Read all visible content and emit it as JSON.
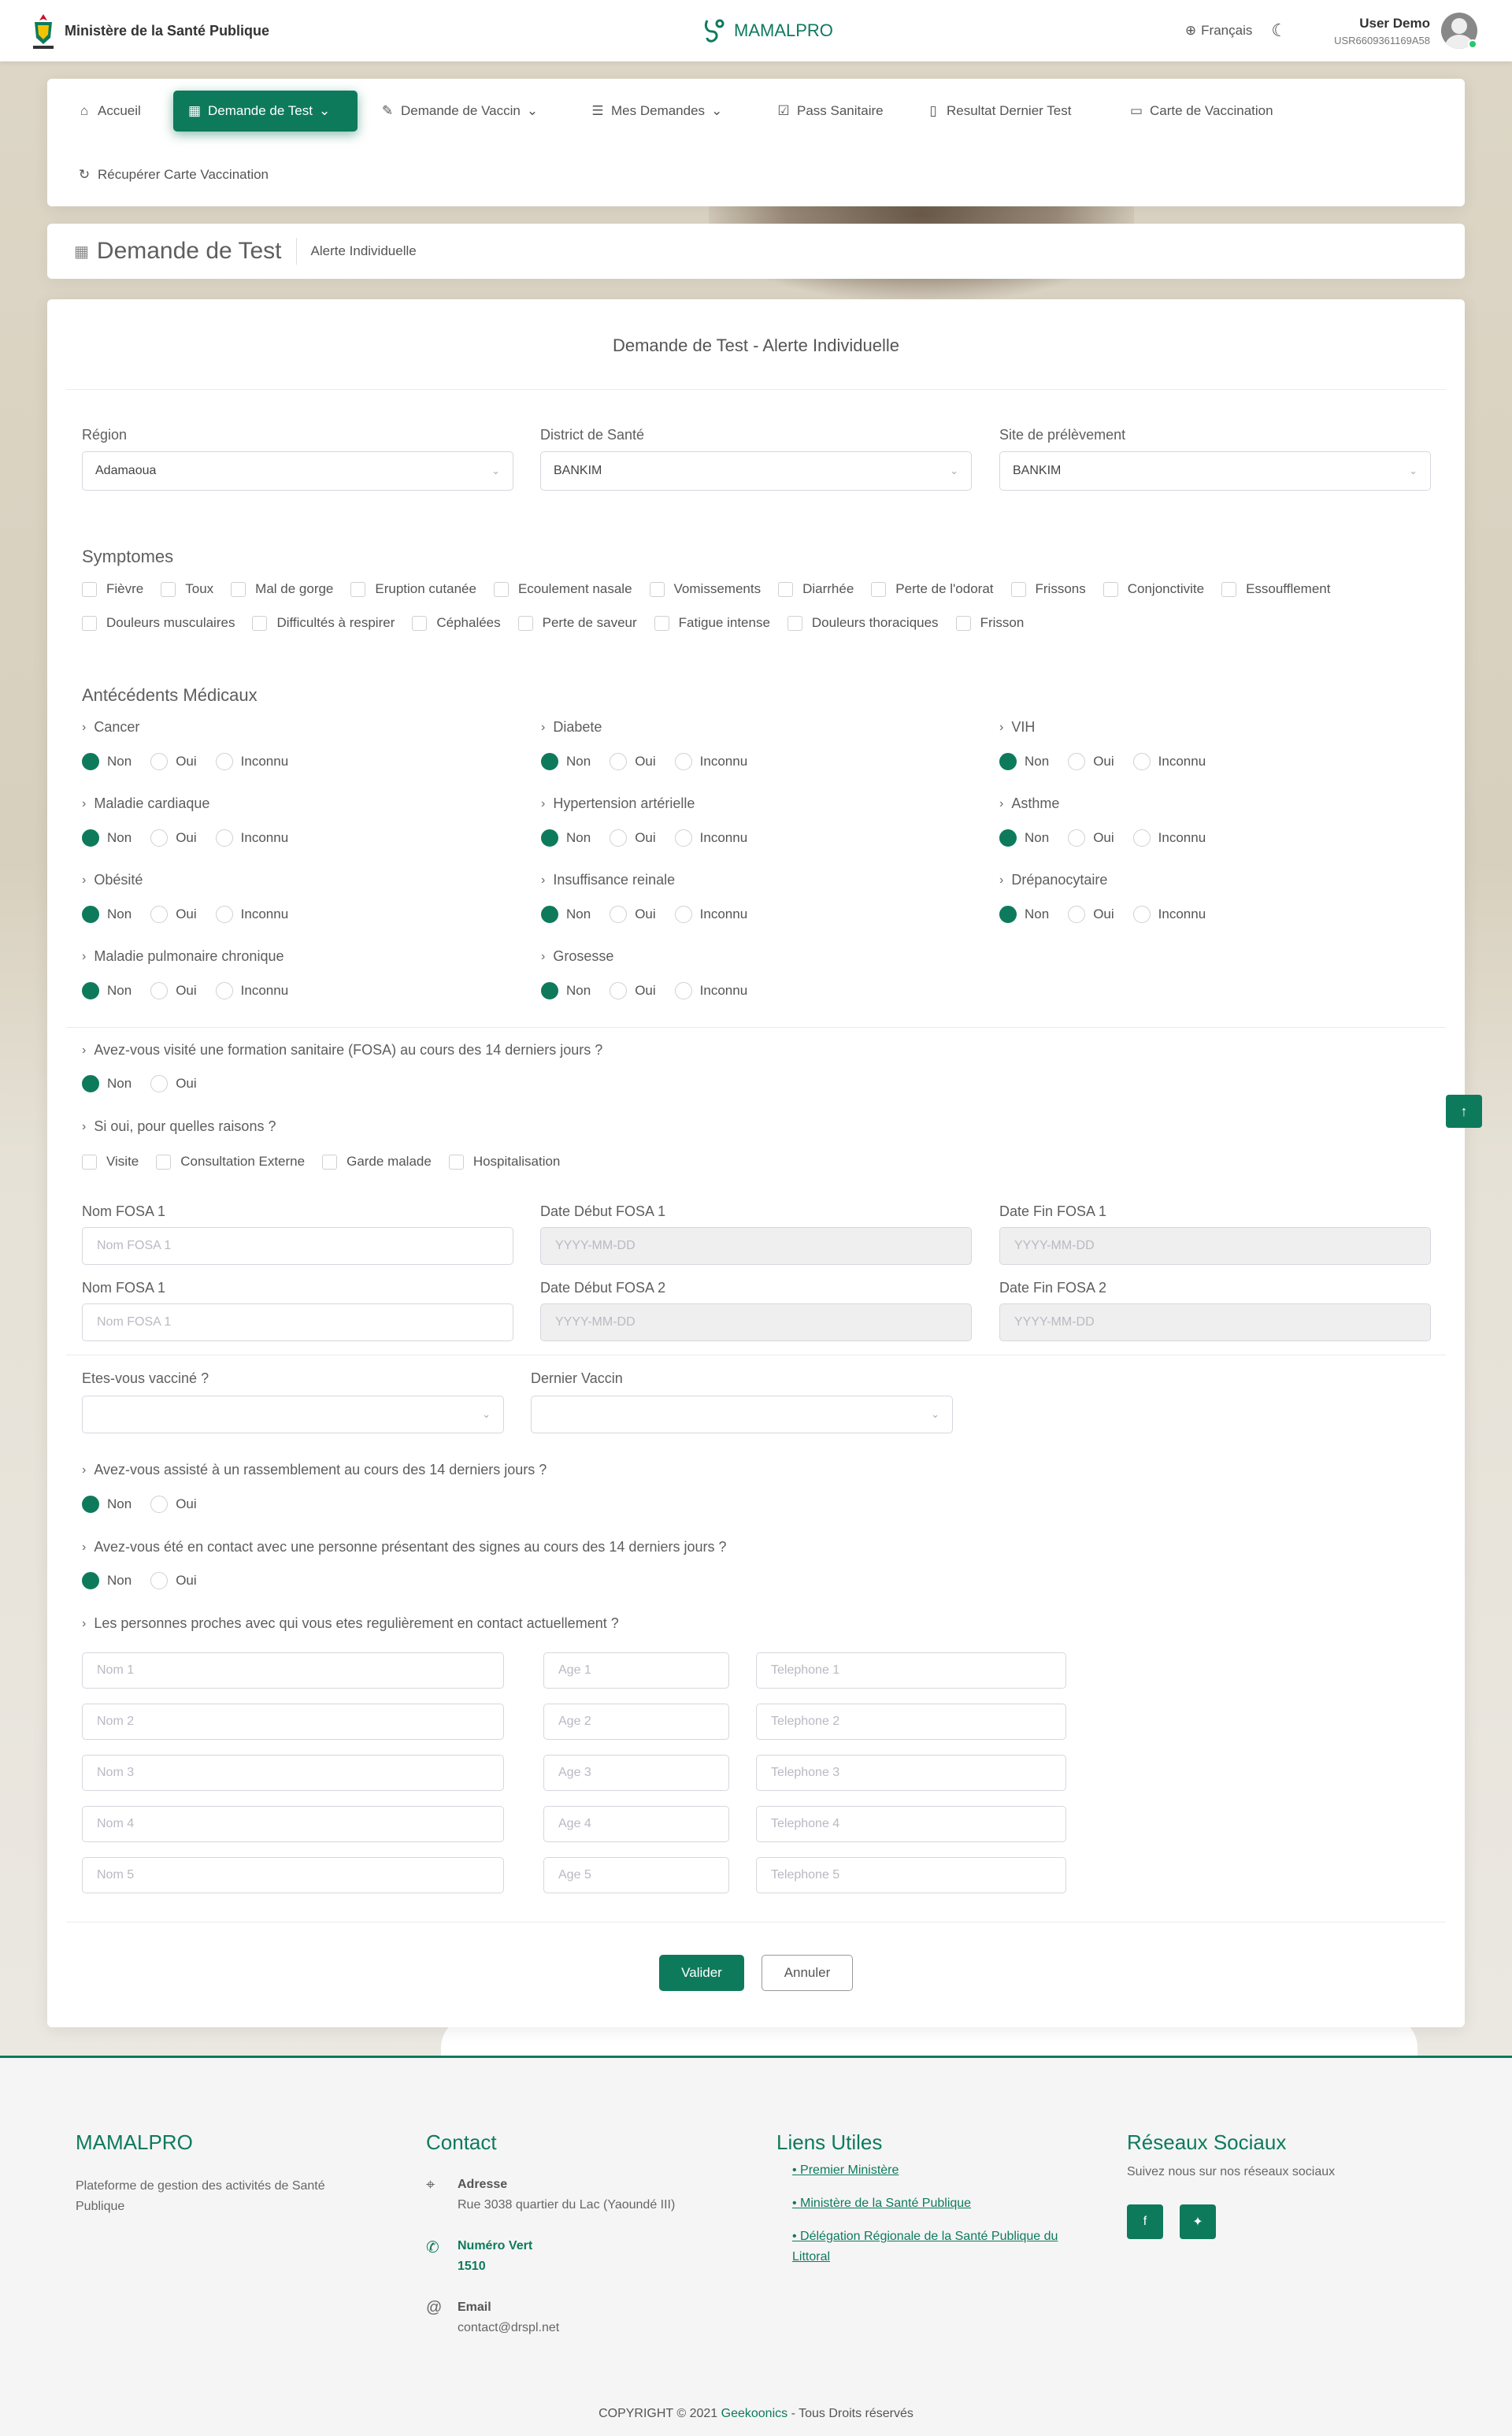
{
  "header": {
    "ministry": "Ministère de la Santé Publique",
    "app_name": "MAMALPRO",
    "language": "Français",
    "user_name": "User Demo",
    "user_id": "USR6609361169A58"
  },
  "nav": {
    "items": [
      "Accueil",
      "Demande de Test",
      "Demande de Vaccin",
      "Mes Demandes",
      "Pass Sanitaire",
      "Resultat Dernier Test",
      "Carte de Vaccination",
      "Récupérer Carte Vaccination"
    ]
  },
  "breadcrumb": {
    "title": "Demande de Test",
    "sub": "Alerte Individuelle"
  },
  "form": {
    "title": "Demande de Test - Alerte Individuelle",
    "region_label": "Région",
    "region_value": "Adamaoua",
    "district_label": "District de Santé",
    "district_value": "BANKIM",
    "site_label": "Site de prélèvement",
    "site_value": "BANKIM",
    "symptoms_title": "Symptomes",
    "symptoms_row1": [
      "Fièvre",
      "Toux",
      "Mal de gorge",
      "Eruption cutanée",
      "Ecoulement nasale",
      "Vomissements",
      "Diarrhée",
      "Perte de l'odorat",
      "Frissons",
      "Conjonctivite",
      "Essoufflement"
    ],
    "symptoms_row2": [
      "Douleurs musculaires",
      "Difficultés à respirer",
      "Céphalées",
      "Perte de saveur",
      "Fatigue intense",
      "Douleurs thoraciques",
      "Frisson"
    ],
    "history_title": "Antécédents Médicaux",
    "history": [
      "Cancer",
      "Diabete",
      "VIH",
      "Maladie cardiaque",
      "Hypertension artérielle",
      "Asthme",
      "Obésité",
      "Insuffisance reinale",
      "Drépanocytaire",
      "Maladie pulmonaire chronique",
      "Grosesse"
    ],
    "opt_non": "Non",
    "opt_oui": "Oui",
    "opt_inconnu": "Inconnu",
    "q_fosa": "Avez-vous visité une formation sanitaire (FOSA) au cours des 14 derniers jours ?",
    "q_reasons": "Si oui, pour quelles raisons ?",
    "reasons": [
      "Visite",
      "Consultation Externe",
      "Garde malade",
      "Hospitalisation"
    ],
    "fosa1_name_label": "Nom FOSA 1",
    "fosa1_start_label": "Date Début FOSA 1",
    "fosa1_end_label": "Date Fin FOSA 1",
    "fosa2_name_label": "Nom FOSA 1",
    "fosa2_start_label": "Date Début FOSA 2",
    "fosa2_end_label": "Date Fin FOSA 2",
    "fosa_name_ph": "Nom FOSA 1",
    "date_ph": "YYYY-MM-DD",
    "vaccinated_label": "Etes-vous vacciné ?",
    "last_vaccine_label": "Dernier Vaccin",
    "q_gathering": "Avez-vous assisté à un rassemblement au cours des 14 derniers jours ?",
    "q_contact": "Avez-vous été en contact avec une personne présentant des signes au cours des 14 derniers jours ?",
    "q_close": "Les personnes proches avec qui vous etes regulièrement en contact actuellement ?",
    "contacts": [
      {
        "nom": "Nom 1",
        "age": "Age 1",
        "tel": "Telephone 1"
      },
      {
        "nom": "Nom 2",
        "age": "Age 2",
        "tel": "Telephone 2"
      },
      {
        "nom": "Nom 3",
        "age": "Age 3",
        "tel": "Telephone 3"
      },
      {
        "nom": "Nom 4",
        "age": "Age 4",
        "tel": "Telephone 4"
      },
      {
        "nom": "Nom 5",
        "age": "Age 5",
        "tel": "Telephone 5"
      }
    ],
    "submit": "Valider",
    "cancel": "Annuler"
  },
  "footer": {
    "brand": "MAMALPRO",
    "brand_desc": "Plateforme de gestion des activités de Santé Publique",
    "contact_title": "Contact",
    "address_label": "Adresse",
    "address": "Rue 3038 quartier du Lac (Yaoundé III)",
    "green_label": "Numéro Vert",
    "green_number": "1510",
    "email_label": "Email",
    "email": "contact@drspl.net",
    "links_title": "Liens Utiles",
    "links": [
      "Premier Ministère",
      "Ministère de la Santé Publique",
      "Délégation Régionale de la Santé Publique du Littoral"
    ],
    "social_title": "Réseaux Sociaux",
    "social_desc": "Suivez nous sur nos réseaux sociaux",
    "copyright": "COPYRIGHT © 2021",
    "company": "Geekoonics",
    "rights": "- Tous Droits réservés"
  },
  "colors": {
    "primary": "#0e7a5c"
  }
}
